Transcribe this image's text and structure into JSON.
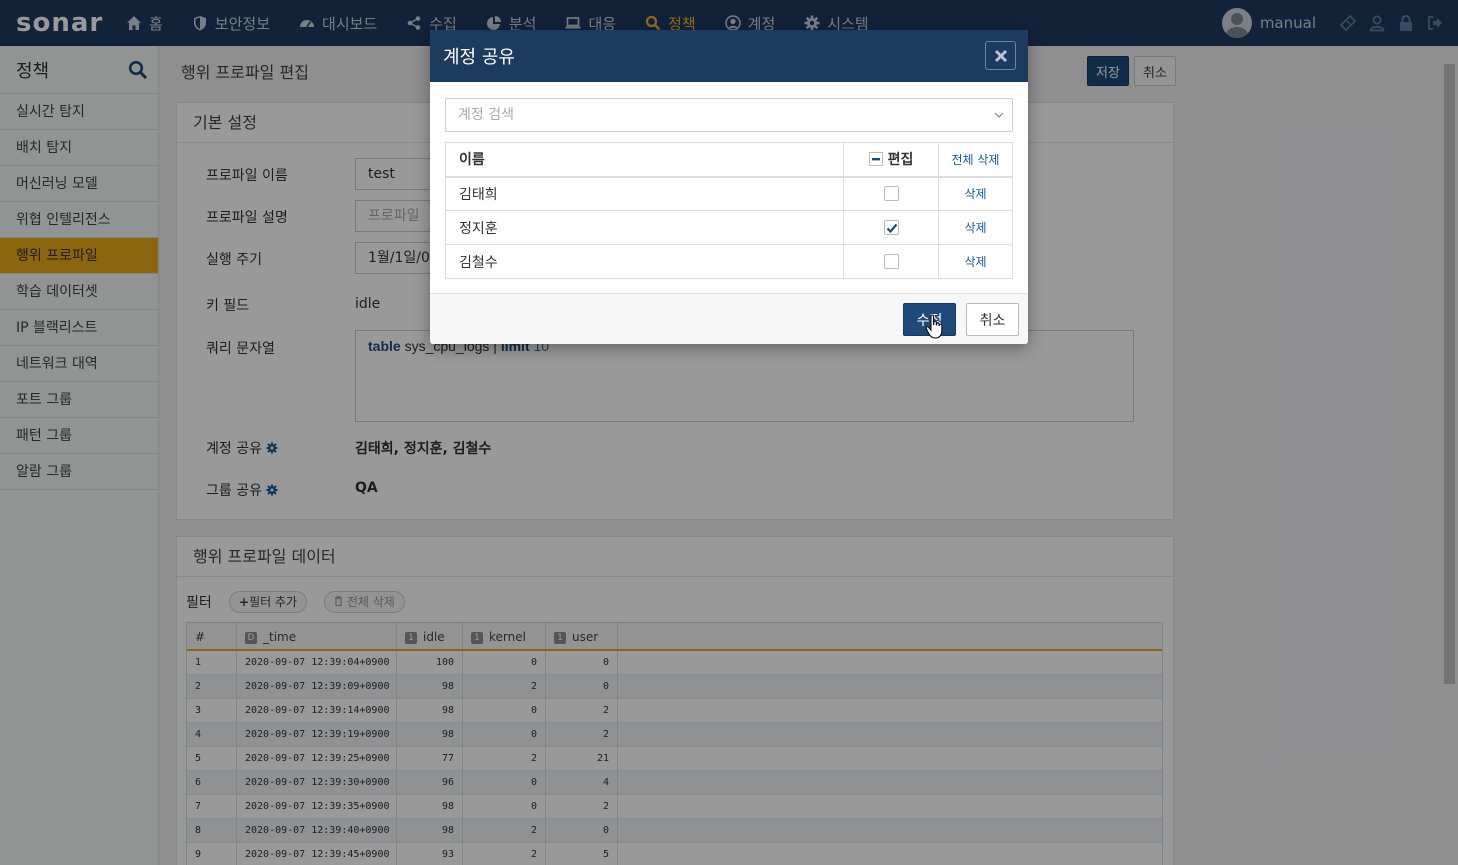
{
  "brand": {
    "logo_text": "sonar"
  },
  "nav": {
    "items": [
      {
        "label": "홈",
        "icon": "home-icon"
      },
      {
        "label": "보안정보",
        "icon": "shield-icon"
      },
      {
        "label": "대시보드",
        "icon": "dashboard-icon"
      },
      {
        "label": "수집",
        "icon": "share-icon"
      },
      {
        "label": "분석",
        "icon": "pie-chart-icon"
      },
      {
        "label": "대응",
        "icon": "laptop-icon"
      },
      {
        "label": "정책",
        "icon": "search-icon",
        "active": true
      },
      {
        "label": "계정",
        "icon": "user-circle-icon"
      },
      {
        "label": "시스템",
        "icon": "gear-icon"
      }
    ],
    "username": "manual"
  },
  "sidebar": {
    "title": "정책",
    "items": [
      {
        "label": "실시간 탐지"
      },
      {
        "label": "배치 탐지"
      },
      {
        "label": "머신러닝 모델"
      },
      {
        "label": "위협 인텔리전스"
      },
      {
        "label": "행위 프로파일",
        "active": true
      },
      {
        "label": "학습 데이터셋"
      },
      {
        "label": "IP 블랙리스트"
      },
      {
        "label": "네트워크 대역"
      },
      {
        "label": "포트 그룹"
      },
      {
        "label": "패턴 그룹"
      },
      {
        "label": "알람 그룹"
      }
    ]
  },
  "page": {
    "title": "행위 프로파일 편집",
    "save_label": "저장",
    "cancel_label": "취소"
  },
  "basic": {
    "header": "기본 설정",
    "name_label": "프로파일 이름",
    "name_value": "test",
    "desc_label": "프로파일 설명",
    "desc_placeholder": "프로파일",
    "cycle_label": "실행 주기",
    "cycle_value": "1월/1일/0",
    "key_label": "키 필드",
    "key_value": "idle",
    "query_label": "쿼리 문자열",
    "query_kw1": "table",
    "query_mid": " sys_cpu_logs | ",
    "query_kw2": "limit",
    "query_num": " 10",
    "account_share_label": "계정 공유",
    "account_share_value": "김태희, 정지훈, 김철수",
    "group_share_label": "그룹 공유",
    "group_share_value": "QA"
  },
  "data_section": {
    "header": "행위 프로파일 데이터",
    "filter_label": "필터",
    "add_filter_label": "필터 추가",
    "clear_all_label": "전체 삭제",
    "columns": [
      {
        "label": "#",
        "badge": ""
      },
      {
        "label": "_time",
        "badge": "D"
      },
      {
        "label": "idle",
        "badge": "1"
      },
      {
        "label": "kernel",
        "badge": "1"
      },
      {
        "label": "user",
        "badge": "1"
      }
    ],
    "rows": [
      [
        "1",
        "2020-09-07 12:39:04+0900",
        "100",
        "0",
        "0"
      ],
      [
        "2",
        "2020-09-07 12:39:09+0900",
        "98",
        "2",
        "0"
      ],
      [
        "3",
        "2020-09-07 12:39:14+0900",
        "98",
        "0",
        "2"
      ],
      [
        "4",
        "2020-09-07 12:39:19+0900",
        "98",
        "0",
        "2"
      ],
      [
        "5",
        "2020-09-07 12:39:25+0900",
        "77",
        "2",
        "21"
      ],
      [
        "6",
        "2020-09-07 12:39:30+0900",
        "96",
        "0",
        "4"
      ],
      [
        "7",
        "2020-09-07 12:39:35+0900",
        "98",
        "0",
        "2"
      ],
      [
        "8",
        "2020-09-07 12:39:40+0900",
        "98",
        "2",
        "0"
      ],
      [
        "9",
        "2020-09-07 12:39:45+0900",
        "93",
        "2",
        "5"
      ]
    ]
  },
  "modal": {
    "title": "계정 공유",
    "search_placeholder": "계정 검색",
    "col_name": "이름",
    "col_edit": "편집",
    "col_delete_all": "전체 삭제",
    "delete_label": "삭제",
    "accounts": [
      {
        "name": "김태희",
        "edit": false
      },
      {
        "name": "정지훈",
        "edit": true
      },
      {
        "name": "김철수",
        "edit": false
      }
    ],
    "ok_label": "수정",
    "cancel_label": "취소"
  },
  "colors": {
    "topbar": "#1d3a5f",
    "accent": "#e9a919",
    "primary_button": "#1d4a78"
  }
}
